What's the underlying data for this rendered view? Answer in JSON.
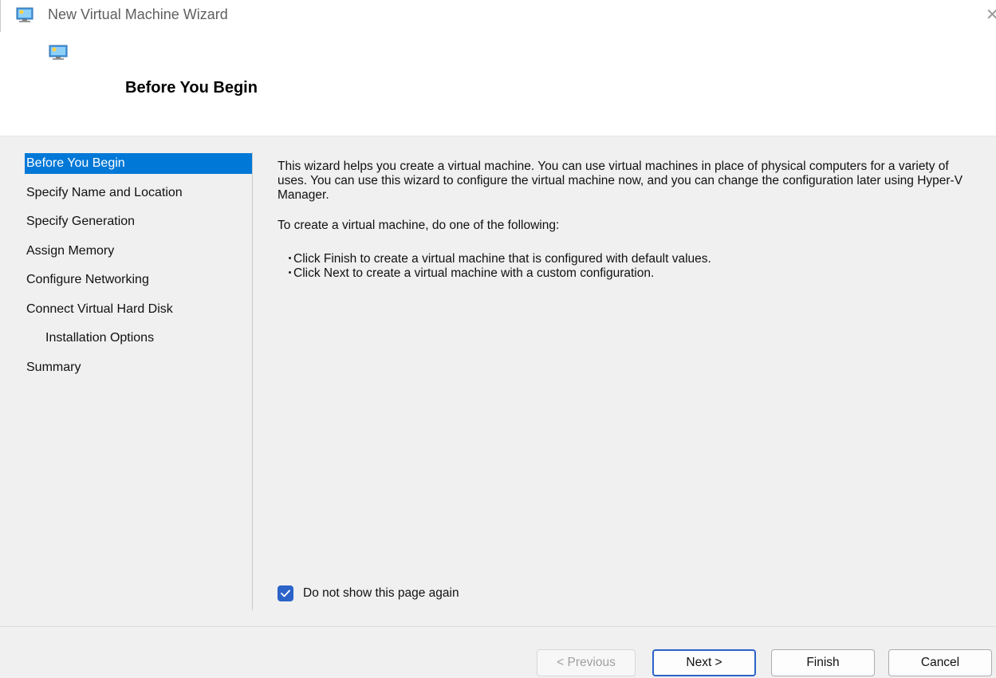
{
  "window": {
    "title": "New Virtual Machine Wizard",
    "close_glyph": "✕",
    "icon": "virtual-machine-icon"
  },
  "header": {
    "title": "Before You Begin",
    "icon": "virtual-machine-icon"
  },
  "nav": {
    "items": [
      {
        "label": "Before You Begin",
        "selected": true,
        "sub": false
      },
      {
        "label": "Specify Name and Location",
        "selected": false,
        "sub": false
      },
      {
        "label": "Specify Generation",
        "selected": false,
        "sub": false
      },
      {
        "label": "Assign Memory",
        "selected": false,
        "sub": false
      },
      {
        "label": "Configure Networking",
        "selected": false,
        "sub": false
      },
      {
        "label": "Connect Virtual Hard Disk",
        "selected": false,
        "sub": false
      },
      {
        "label": "Installation Options",
        "selected": false,
        "sub": true
      },
      {
        "label": "Summary",
        "selected": false,
        "sub": false
      }
    ]
  },
  "content": {
    "paragraph1": "This wizard helps you create a virtual machine. You can use virtual machines in place of physical computers for a variety of uses. You can use this wizard to configure the virtual machine now, and you can change the configuration later using Hyper-V Manager.",
    "paragraph2": "To create a virtual machine, do one of the following:",
    "bullets": [
      "Click Finish to create a virtual machine that is configured with default values.",
      "Click Next to create a virtual machine with a custom configuration."
    ]
  },
  "checkbox": {
    "label": "Do not show this page again",
    "checked": true
  },
  "buttons": {
    "previous": "< Previous",
    "next": "Next >",
    "finish": "Finish",
    "cancel": "Cancel"
  },
  "colors": {
    "selection": "#0078d7",
    "checkbox": "#2b63c9",
    "panel_bg": "#f0f0f0"
  }
}
